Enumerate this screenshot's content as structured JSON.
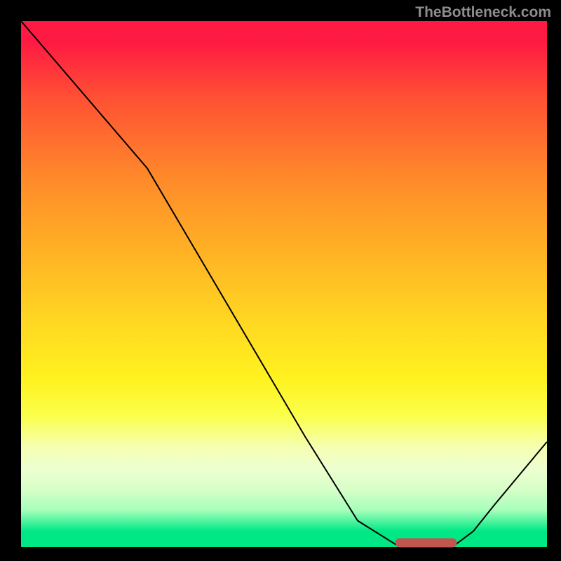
{
  "watermark": "TheBottleneck.com",
  "colors": {
    "curve": "#000000",
    "marker": "#c1554f",
    "gradient_top": "#ff1a43",
    "gradient_bottom": "#00e885"
  },
  "chart_data": {
    "type": "line",
    "title": "",
    "xlabel": "",
    "ylabel": "",
    "xlim": [
      0,
      100
    ],
    "ylim": [
      0,
      100
    ],
    "grid": false,
    "legend": false,
    "series": [
      {
        "name": "bottleneck-curve",
        "x": [
          0,
          6,
          12,
          18,
          24,
          34,
          44,
          54,
          64,
          72,
          77,
          82,
          86,
          90,
          95,
          100
        ],
        "y": [
          100,
          93,
          86,
          79,
          72,
          55,
          38,
          21,
          5,
          0,
          0,
          0,
          3,
          8,
          14,
          20
        ]
      }
    ],
    "annotations": [
      {
        "name": "optimal-range",
        "type": "segment",
        "x0": 72,
        "x1": 82,
        "y": 0
      }
    ]
  }
}
